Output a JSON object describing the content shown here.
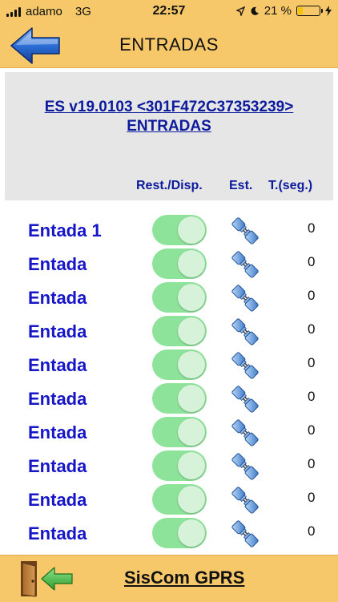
{
  "status_bar": {
    "carrier": "adamo",
    "network": "3G",
    "time": "22:57",
    "battery": "21 %"
  },
  "navbar": {
    "title": "ENTRADAS",
    "back_icon": "back-arrow-icon"
  },
  "header": {
    "device_line": "ES v19.0103 <301F472C37353239>",
    "subtitle": "ENTRADAS",
    "columns": {
      "rest_disp": "Rest./Disp.",
      "est": "Est.",
      "time": "T.(seg.)"
    }
  },
  "inputs": [
    {
      "label": "Entada 1",
      "enabled": true,
      "value": "0"
    },
    {
      "label": "Entada",
      "enabled": true,
      "value": "0"
    },
    {
      "label": "Entada",
      "enabled": true,
      "value": "0"
    },
    {
      "label": "Entada",
      "enabled": true,
      "value": "0"
    },
    {
      "label": "Entada",
      "enabled": true,
      "value": "0"
    },
    {
      "label": "Entada",
      "enabled": true,
      "value": "0"
    },
    {
      "label": "Entada",
      "enabled": true,
      "value": "0"
    },
    {
      "label": "Entada",
      "enabled": true,
      "value": "0"
    },
    {
      "label": "Entada",
      "enabled": true,
      "value": "0"
    },
    {
      "label": "Entada",
      "enabled": true,
      "value": "0"
    }
  ],
  "footer": {
    "title": "SisCom GPRS",
    "exit_icon": "exit-door-icon"
  },
  "colors": {
    "bar": "#f7c86a",
    "label_blue": "#1616c8",
    "header_blue": "#0c1a9c",
    "toggle_on": "#8de39a"
  }
}
